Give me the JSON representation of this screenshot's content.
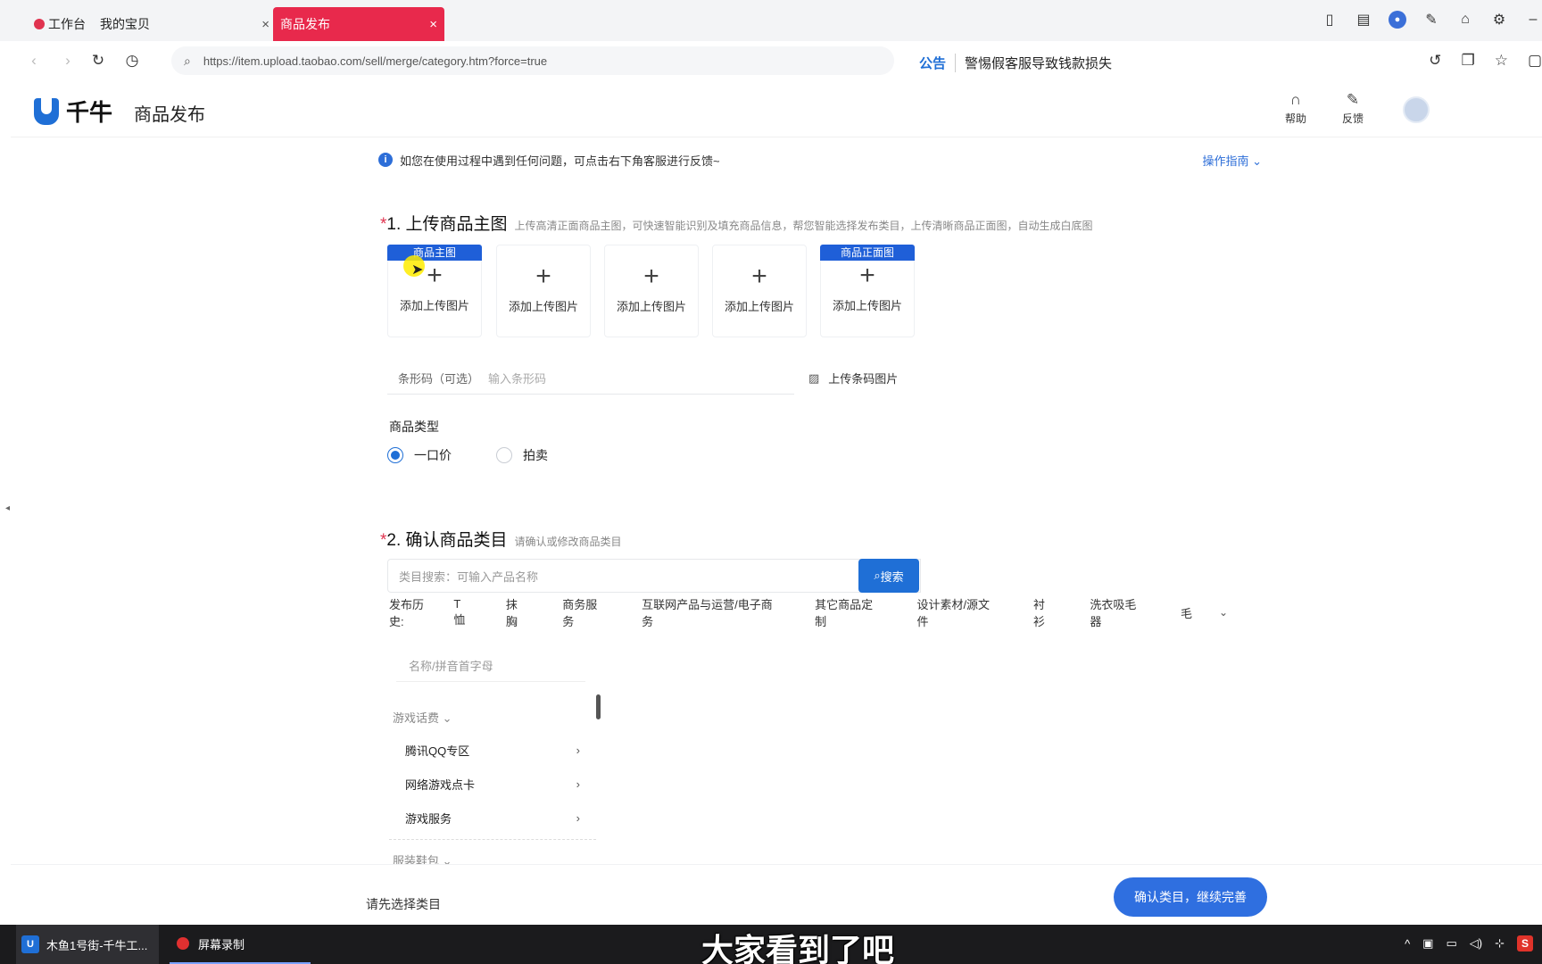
{
  "tabs": [
    {
      "label": "工作台"
    },
    {
      "label": "我的宝贝"
    },
    {
      "label": "商品发布"
    }
  ],
  "address": {
    "url": "https://item.upload.taobao.com/sell/merge/category.htm?force=true",
    "notice_label": "公告",
    "notice_text": "警惕假客服导致钱款损失"
  },
  "header": {
    "logo_text": "千牛",
    "page_title": "商品发布",
    "help_label": "帮助",
    "feedback_label": "反馈"
  },
  "info": {
    "text": "如您在使用过程中遇到任何问题，可点击右下角客服进行反馈~",
    "guide_label": "操作指南"
  },
  "section1": {
    "star": "*",
    "title": "1. 上传商品主图",
    "hint": "上传高清正面商品主图，可快速智能识别及填充商品信息，帮您智能选择发布类目，上传清晰商品正面图，自动生成白底图",
    "uploads": [
      {
        "badge": "商品主图",
        "caption": "添加上传图片"
      },
      {
        "badge": "",
        "caption": "添加上传图片"
      },
      {
        "badge": "",
        "caption": "添加上传图片"
      },
      {
        "badge": "",
        "caption": "添加上传图片"
      },
      {
        "badge": "商品正面图",
        "caption": "添加上传图片"
      }
    ],
    "barcode_label": "条形码（可选）",
    "barcode_placeholder": "输入条形码",
    "barcode_upload": "上传条码图片",
    "type_label": "商品类型",
    "type_options": [
      "一口价",
      "拍卖"
    ],
    "type_selected": "一口价"
  },
  "section2": {
    "star": "*",
    "title": "2. 确认商品类目",
    "hint": "请确认或修改商品类目",
    "search_placeholder": "类目搜索：可输入产品名称",
    "search_button": "搜索",
    "history_label": "发布历史:",
    "history": [
      "T恤",
      "抹胸",
      "商务服务",
      "互联网产品与运营/电子商务",
      "其它商品定制",
      "设计素材/源文件",
      "衬衫",
      "洗衣吸毛器",
      "毛"
    ],
    "name_placeholder": "名称/拼音首字母",
    "groups": [
      {
        "name": "游戏话费",
        "items": [
          "腾讯QQ专区",
          "网络游戏点卡",
          "游戏服务"
        ]
      },
      {
        "name": "服装鞋包",
        "items": []
      }
    ]
  },
  "bottom": {
    "tip": "请先选择类目",
    "confirm": "确认类目，继续完善"
  },
  "taskbar": {
    "app1": "木鱼1号街-千牛工...",
    "app2": "屏幕录制",
    "subtitle": "大家看到了吧"
  },
  "colors": {
    "accent": "#1f6fd6",
    "active_tab": "#e8294c",
    "required": "#e0334f"
  }
}
